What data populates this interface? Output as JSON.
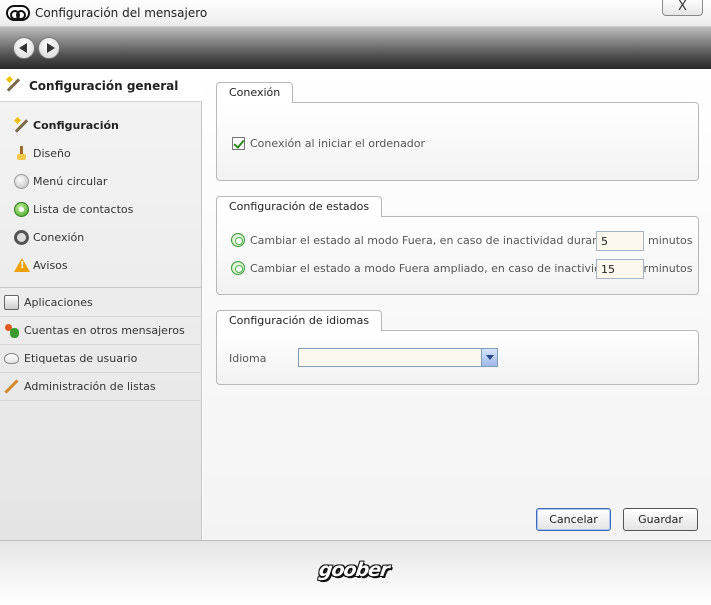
{
  "window": {
    "title": "Configuración del mensajero",
    "close_label": "X"
  },
  "toolbar": {
    "back": "back",
    "forward": "forward"
  },
  "sidebar": {
    "header": {
      "label": "Configuración general",
      "icon": "wand-icon"
    },
    "sub_items": [
      {
        "label": "Configuración",
        "icon": "wand-icon",
        "active": true
      },
      {
        "label": "Diseño",
        "icon": "brush-icon"
      },
      {
        "label": "Menú circular",
        "icon": "circle-menu-icon"
      },
      {
        "label": "Lista de contactos",
        "icon": "contacts-icon"
      },
      {
        "label": "Conexión",
        "icon": "connection-icon"
      },
      {
        "label": "Avisos",
        "icon": "warning-icon"
      }
    ],
    "top_items": [
      {
        "label": "Aplicaciones",
        "icon": "applications-icon"
      },
      {
        "label": "Cuentas en otros mensajeros",
        "icon": "accounts-icon"
      },
      {
        "label": "Etiquetas de usuario",
        "icon": "tag-icon"
      },
      {
        "label": "Administración de listas",
        "icon": "pencil-icon"
      }
    ]
  },
  "main": {
    "connection": {
      "tab": "Conexión",
      "startup_label": "Conexión al iniciar el ordenador",
      "startup_checked": true
    },
    "status": {
      "tab": "Configuración de estados",
      "away_label": "Cambiar el estado al modo Fuera, en caso de inactividad durante:",
      "away_value": "5",
      "away_unit": "minutos",
      "extended_label": "Cambiar el estado a modo Fuera ampliado, en caso de inactividad durar",
      "extended_value": "15",
      "extended_unit": "minutos"
    },
    "language": {
      "tab": "Configuración de idiomas",
      "label": "Idioma",
      "selected": ""
    },
    "buttons": {
      "cancel": "Cancelar",
      "save": "Guardar"
    }
  },
  "footer": {
    "logo": "goober"
  }
}
